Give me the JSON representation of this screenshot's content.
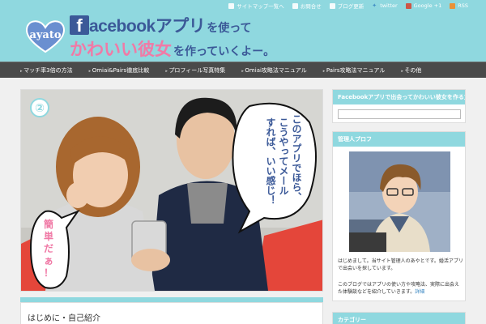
{
  "colors": {
    "accent": "#8fd8df",
    "nav": "#4a4a4a",
    "brand": "#3b5998",
    "pink": "#f07aa6"
  },
  "top_links": [
    {
      "label": "サイトマップ一覧へ",
      "icon": "home-icon"
    },
    {
      "label": "お問合せ",
      "icon": "mail-icon"
    },
    {
      "label": "ブログ更新",
      "icon": "note-icon"
    },
    {
      "label": "twitter",
      "icon": "twitter-icon"
    },
    {
      "label": "Google +1",
      "icon": "google-plus-icon"
    },
    {
      "label": "RSS",
      "icon": "rss-icon"
    }
  ],
  "logo": {
    "text": "ayato"
  },
  "header": {
    "fb_letter": "f",
    "line1a": "acebookアプリ",
    "line1b": "を使って",
    "line2a": "かわいい彼女",
    "line2b": "を作っていくよー。"
  },
  "nav": [
    "マッチ率3倍の方法",
    "Omiai&Pairs徹底比較",
    "プロフィール写真特集",
    "Omiai攻略法マニュアル",
    "Pairs攻略法マニュアル",
    "その他"
  ],
  "hero": {
    "number": "②",
    "bubble_right": [
      "このアプリでほら、",
      "こうやってメール",
      "すれば、いい感じ！"
    ],
    "bubble_left": [
      "簡",
      "単",
      "だ",
      "ぁ",
      "！"
    ]
  },
  "article": {
    "title": "はじめに・自己紹介"
  },
  "sidebar": {
    "widget1_title": "Facebookアプリで出会ってかわいい彼女を作る方法",
    "search_placeholder": "",
    "widget2_title": "管理人プロフ",
    "profile_text_1": "はじめまして。当サイト管理人のあやとです。婚活アプリで出会いを探しています。",
    "profile_text_2": "このブログではアプリの使い方や攻略法、実際に出会えた体験談などを紹介していきます。",
    "profile_link": "詳細",
    "widget3_title": "カテゴリー"
  }
}
